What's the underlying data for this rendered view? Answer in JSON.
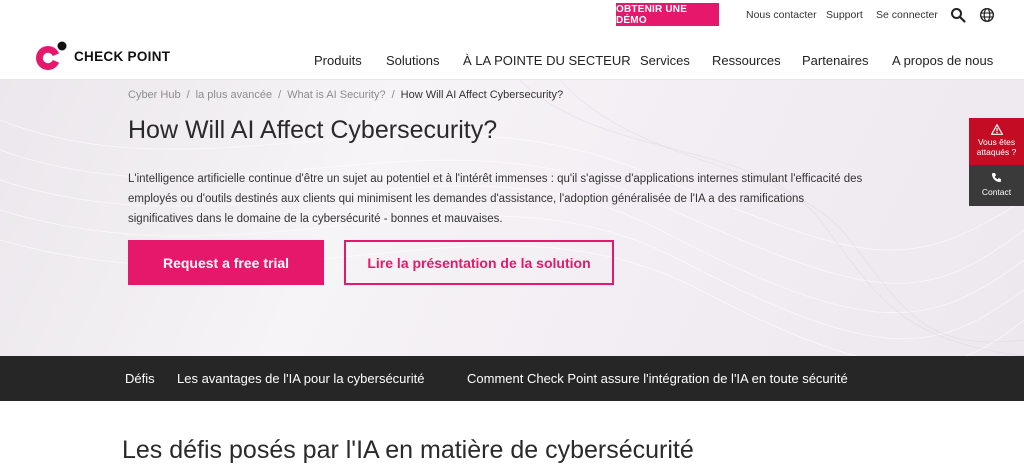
{
  "utility": {
    "demo_label": "OBTENIR UNE DÉMO",
    "contact_label": "Nous contacter",
    "support_label": "Support",
    "login_label": "Se connecter",
    "search_icon": "search-icon",
    "globe_icon": "globe-icon"
  },
  "brand": {
    "name": "CHECK POINT",
    "accent": "#e5186b"
  },
  "nav": {
    "items": [
      "Produits",
      "Solutions",
      "À LA POINTE DU SECTEUR",
      "Services",
      "Ressources",
      "Partenaires",
      "A propos de nous"
    ]
  },
  "breadcrumb": {
    "items": [
      "Cyber Hub",
      "la plus avancée",
      "What is AI Security?",
      "How Will AI Affect Cybersecurity?"
    ]
  },
  "hero": {
    "title": "How Will AI Affect Cybersecurity?",
    "description": "L'intelligence artificielle continue d'être un sujet au potentiel et à l'intérêt immenses : qu'il s'agisse d'applications internes stimulant l'efficacité des employés ou d'outils destinés aux clients qui minimisent les demandes d'assistance, l'adoption généralisée de l'IA a des ramifications significatives dans le domaine de la cybersécurité - bonnes et mauvaises.",
    "primary_cta": "Request a free trial",
    "secondary_cta": "Lire la présentation de la solution"
  },
  "side": {
    "alert_label": "Vous êtes attaqués ?",
    "contact_label": "Contact"
  },
  "tabs": {
    "items": [
      "Défis",
      "Les avantages de l'IA pour la cybersécurité",
      "Comment Check Point assure l'intégration de l'IA en toute sécurité"
    ]
  },
  "section": {
    "title": "Les défis posés par l'IA en matière de cybersécurité"
  }
}
